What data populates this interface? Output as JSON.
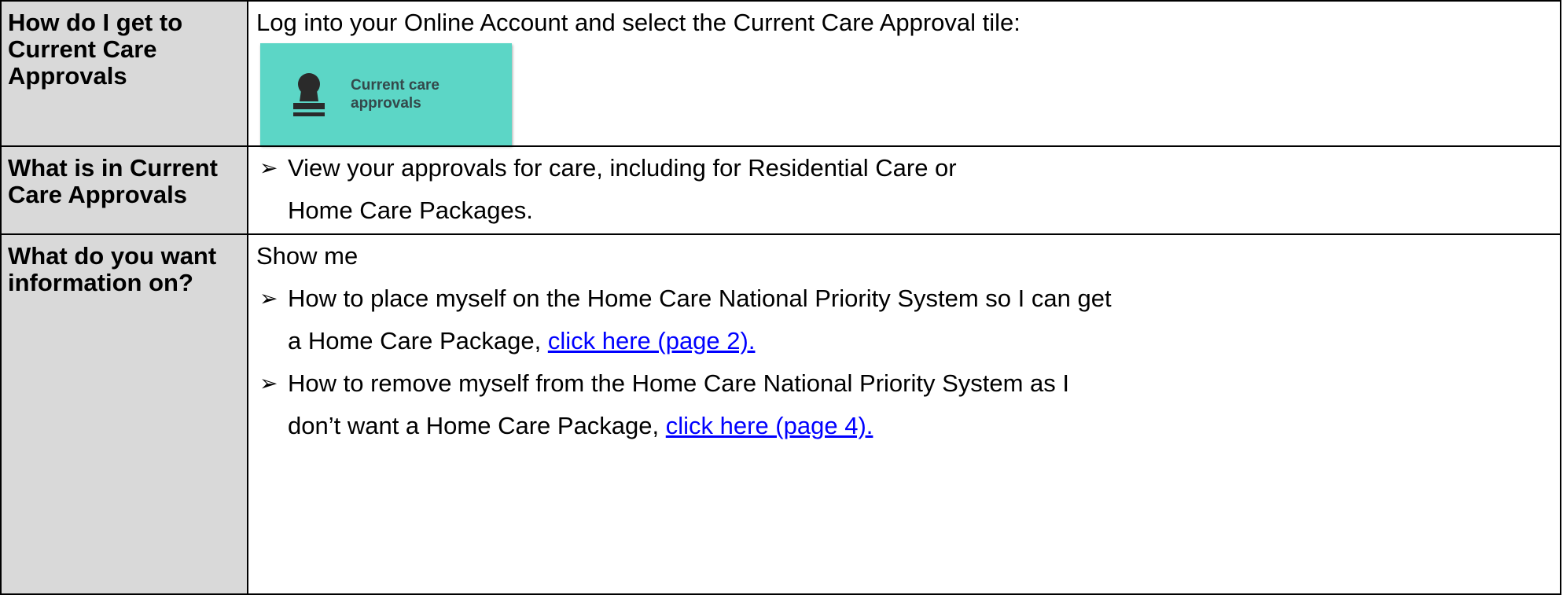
{
  "rows": [
    {
      "header": "How do I get to Current Care Approvals",
      "text": "Log into your Online Account and select the Current Care Approval tile:",
      "tile": {
        "label_line1": "Current care",
        "label_line2": "approvals",
        "icon": "stamp-icon",
        "color": "#5cd6c6"
      }
    },
    {
      "header": "What is in Current Care Approvals",
      "bullets": [
        {
          "line1": "View your approvals for care, including for Residential Care or",
          "line2": "Home Care Packages."
        }
      ]
    },
    {
      "header": "What do you want information on?",
      "intro": "Show me",
      "bullets": [
        {
          "line1": "How to place myself on the Home Care National Priority System so I can get",
          "line2": "a Home Care Package, ",
          "link": "click here (page 2)."
        },
        {
          "line1": "How to remove myself from the Home Care National Priority System as I",
          "line2": "don’t want a Home Care Package, ",
          "link": "click here (page 4)."
        }
      ]
    }
  ],
  "bullet_glyph": "➢",
  "link_color": "#0000ff"
}
